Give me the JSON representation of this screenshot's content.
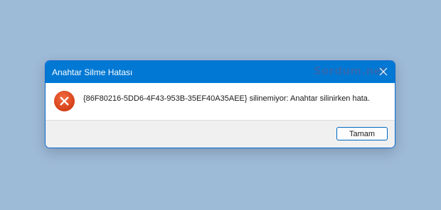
{
  "dialog": {
    "title": "Anahtar Silme Hatası",
    "watermark": "Sordum.net",
    "close_icon": "close-icon",
    "error_icon": "error-x-icon",
    "message": "{86F80216-5DD6-4F43-953B-35EF40A35AEE} silinemiyor:  Anahtar silinirken hata.",
    "ok_label": "Tamam"
  },
  "colors": {
    "desktop_background": "#9dbad7",
    "titlebar": "#0078d4",
    "watermark": "#2f6ab3",
    "error_icon": "#e0451f",
    "footer": "#f0f0f0",
    "button_border": "#0067c0"
  }
}
